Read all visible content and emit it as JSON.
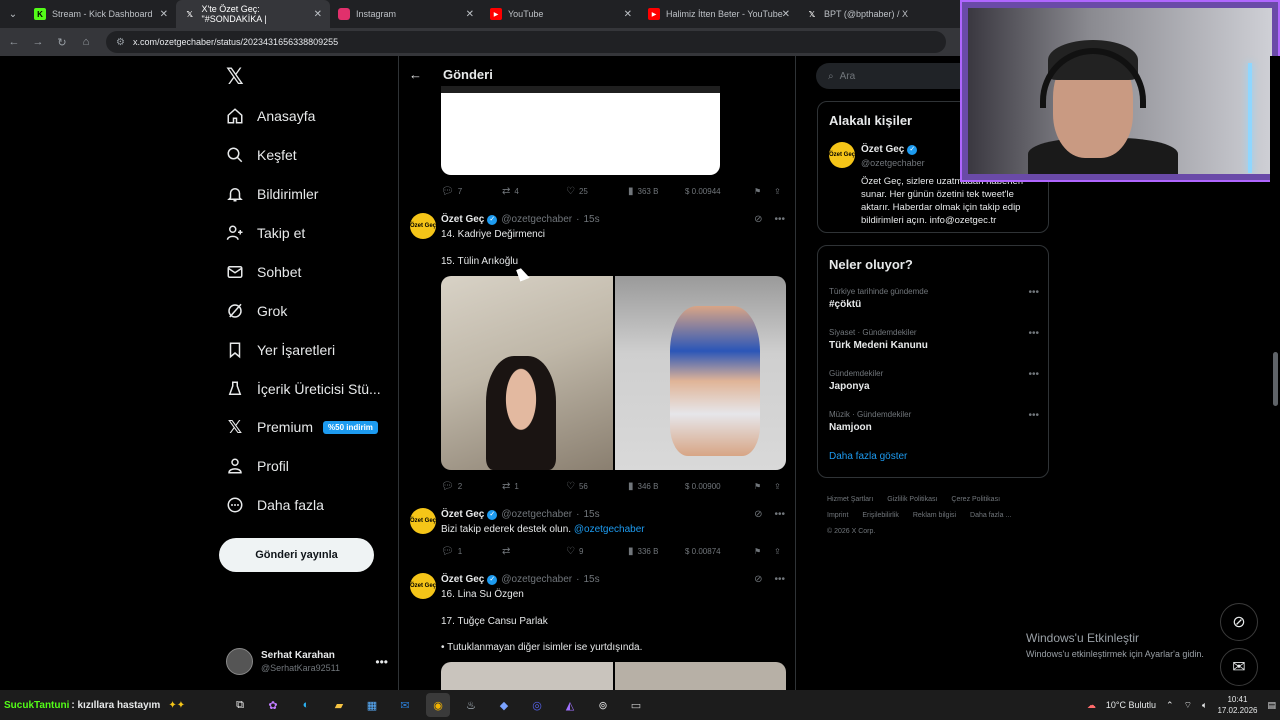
{
  "browser": {
    "tabs": [
      {
        "label": "Stream - Kick Dashboard",
        "icon": "kick-icon",
        "color": "#53fc18"
      },
      {
        "label": "X'te Özet Geç: \"#SONDAKİKA | ",
        "icon": "x-logo-icon",
        "color": "#ffffff"
      },
      {
        "label": "Instagram",
        "icon": "instagram-icon",
        "color": "#e1306c"
      },
      {
        "label": "YouTube",
        "icon": "youtube-icon",
        "color": "#ff0000"
      },
      {
        "label": "Halimiz İtten Beter - YouTube",
        "icon": "youtube-icon",
        "color": "#ff0000"
      },
      {
        "label": "BPT (@bpthaber) / X",
        "icon": "x-logo-icon",
        "color": "#ffffff"
      }
    ],
    "url": "x.com/ozetgechaber/status/2023431656338809255"
  },
  "sidebar": {
    "items": [
      {
        "label": "Anasayfa",
        "icon": "home-icon"
      },
      {
        "label": "Keşfet",
        "icon": "search-icon"
      },
      {
        "label": "Bildirimler",
        "icon": "bell-icon"
      },
      {
        "label": "Takip et",
        "icon": "person-add-icon"
      },
      {
        "label": "Sohbet",
        "icon": "mail-icon"
      },
      {
        "label": "Grok",
        "icon": "grok-icon"
      },
      {
        "label": "Yer İşaretleri",
        "icon": "bookmark-icon"
      },
      {
        "label": "İçerik Üreticisi Stü...",
        "icon": "creator-icon"
      },
      {
        "label": "Premium",
        "icon": "x-logo-icon"
      },
      {
        "label": "Profil",
        "icon": "person-icon"
      },
      {
        "label": "Daha fazla",
        "icon": "more-circle-icon"
      }
    ],
    "premium_badge": "%50 indirim",
    "post_button": "Gönderi yayınla",
    "account": {
      "name": "Serhat Karahan",
      "handle": "@SerhatKara92511"
    }
  },
  "main": {
    "title": "Gönderi",
    "first_actions": {
      "replies": "7",
      "reposts": "4",
      "likes": "25",
      "views": "363 B",
      "price": "$ 0.00944"
    },
    "tweets": [
      {
        "avatar_text": "Özet Geç",
        "name": "Özet Geç",
        "handle": "@ozetgechaber",
        "time": "15s",
        "line1": "14. Kadriye Değirmenci",
        "line2": "15. Tülin Arıkoğlu",
        "actions": {
          "replies": "2",
          "reposts": "1",
          "likes": "56",
          "views": "346 B",
          "price": "$ 0.00900"
        }
      },
      {
        "avatar_text": "Özet Geç",
        "name": "Özet Geç",
        "handle": "@ozetgechaber",
        "time": "15s",
        "line1": "Bizi takip ederek destek olun.",
        "mention": "@ozetgechaber",
        "actions": {
          "replies": "1",
          "reposts": "",
          "likes": "9",
          "views": "336 B",
          "price": "$ 0.00874"
        }
      },
      {
        "avatar_text": "Özet Geç",
        "name": "Özet Geç",
        "handle": "@ozetgechaber",
        "time": "15s",
        "line1": "16. Lina Su Özgen",
        "line2": "17. Tuğçe Cansu Parlak",
        "line3": "• Tutuklanmayan diğer isimler ise yurtdışında."
      }
    ]
  },
  "right": {
    "search_placeholder": "Ara",
    "related_title": "Alakalı kişiler",
    "related": {
      "avatar_text": "Özet Geç",
      "name": "Özet Geç",
      "handle": "@ozetgechaber",
      "bio": "Özet Geç, sizlere uzatmadan haberleri sunar. Her günün özetini tek tweet'le aktarır. Haberdar olmak için takip edip bildirimleri açın. info@ozetgec.tr"
    },
    "trends_title": "Neler oluyor?",
    "trends": [
      {
        "context": "Türkiye tarihinde gündemde",
        "name": "#çöktü"
      },
      {
        "context": "Siyaset · Gündemdekiler",
        "name": "Türk Medeni Kanunu"
      },
      {
        "context": "Gündemdekiler",
        "name": "Japonya"
      },
      {
        "context": "Müzik · Gündemdekiler",
        "name": "Namjoon"
      }
    ],
    "show_more": "Daha fazla göster",
    "footer": [
      "Hizmet Şartları",
      "Gizlilik Politikası",
      "Çerez Politikası",
      "Imprint",
      "Erişilebilirlik",
      "Reklam bilgisi",
      "Daha fazla ...",
      "© 2026 X Corp."
    ]
  },
  "windows": {
    "activate_title": "Windows'u Etkinleştir",
    "activate_sub": "Windows'u etkinleştirmek için Ayarlar'a gidin."
  },
  "taskbar": {
    "ticker_brand": "SucukTantuni",
    "ticker_text": ": kızıllara hastayım",
    "weather": "10°C  Bulutlu",
    "time": "10:41",
    "date": "17.02.2026"
  }
}
